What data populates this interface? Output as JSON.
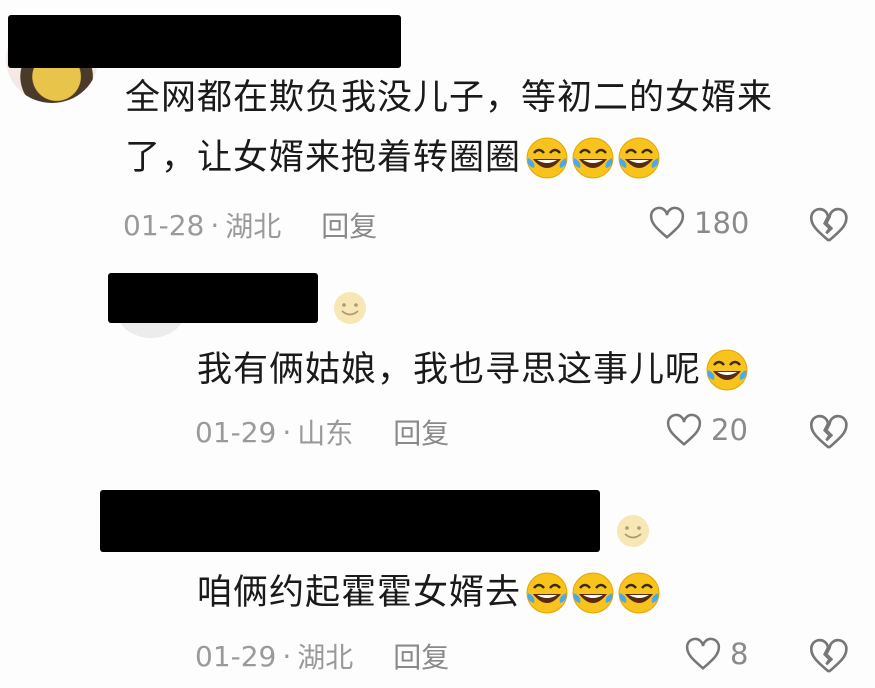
{
  "comments": [
    {
      "text_line1": "全网都在欺负我没儿子，等初二的女婿来",
      "text_line2": "了，让女婿来抱着转圈圈",
      "date": "01-28",
      "dot": "·",
      "location": "湖北",
      "reply_label": "回复",
      "likes": "180"
    },
    {
      "text": "我有俩姑娘，我也寻思这事儿呢",
      "date": "01-29",
      "dot": "·",
      "location": "山东",
      "reply_label": "回复",
      "likes": "20"
    },
    {
      "text": "咱俩约起霍霍女婿去",
      "date": "01-29",
      "dot": "·",
      "location": "湖北",
      "reply_label": "回复",
      "likes": "8"
    }
  ],
  "icons": {
    "emoji": "laughing-crying-emoji",
    "like": "heart-outline-icon",
    "dislike": "broken-heart-icon",
    "author_badge": "smile-emoji"
  },
  "colors": {
    "text": "#1a1a1a",
    "meta": "#9a9a9a",
    "emoji": "#f5c518",
    "redaction": "#000000"
  }
}
